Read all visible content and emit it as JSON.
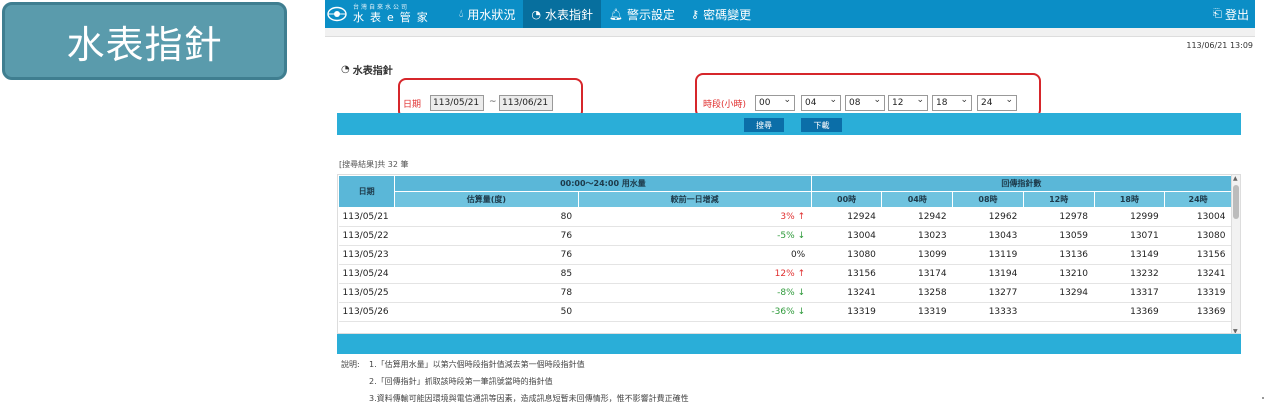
{
  "badge": {
    "label": "水表指針"
  },
  "header": {
    "logo_small": "台灣自來水公司",
    "logo_big": "水表e管家",
    "nav": [
      {
        "label": "用水狀況",
        "icon": "drop-icon"
      },
      {
        "label": "水表指針",
        "icon": "gauge-icon"
      },
      {
        "label": "警示設定",
        "icon": "bell-icon"
      },
      {
        "label": "密碼變更",
        "icon": "key-icon"
      }
    ],
    "logout_label": "登出",
    "colors": {
      "topbar": "#0b8ec6",
      "active": "#076f9e",
      "accent": "#2aaed8"
    }
  },
  "timestamp": "113/06/21 13:09",
  "page_title": "水表指針",
  "filter": {
    "date_label": "日期",
    "date_from": "113/05/21",
    "date_to": "113/06/21",
    "tilde": "~",
    "hour_label": "時段(小時)",
    "hours": [
      "00",
      "04",
      "08",
      "12",
      "18",
      "24"
    ]
  },
  "buttons": {
    "search": "搜尋",
    "download": "下載"
  },
  "result_count": "[搜尋結果]共 32 筆",
  "table": {
    "date_header": "日期",
    "usage_group": "00:00～24:00 用水量",
    "reading_group": "回傳指針數",
    "usage_cols": [
      "估算量(度)",
      "較前一日增減"
    ],
    "hour_cols": [
      "00時",
      "04時",
      "08時",
      "12時",
      "18時",
      "24時"
    ],
    "rows": [
      {
        "date": "113/05/21",
        "usage": "80",
        "change": "3%",
        "dir": "up",
        "readings": [
          "12924",
          "12942",
          "12962",
          "12978",
          "12999",
          "13004"
        ]
      },
      {
        "date": "113/05/22",
        "usage": "76",
        "change": "-5%",
        "dir": "down",
        "readings": [
          "13004",
          "13023",
          "13043",
          "13059",
          "13071",
          "13080"
        ]
      },
      {
        "date": "113/05/23",
        "usage": "76",
        "change": "0%",
        "dir": "none",
        "readings": [
          "13080",
          "13099",
          "13119",
          "13136",
          "13149",
          "13156"
        ]
      },
      {
        "date": "113/05/24",
        "usage": "85",
        "change": "12%",
        "dir": "up",
        "readings": [
          "13156",
          "13174",
          "13194",
          "13210",
          "13232",
          "13241"
        ]
      },
      {
        "date": "113/05/25",
        "usage": "78",
        "change": "-8%",
        "dir": "down",
        "readings": [
          "13241",
          "13258",
          "13277",
          "13294",
          "13317",
          "13319"
        ]
      },
      {
        "date": "113/05/26",
        "usage": "50",
        "change": "-36%",
        "dir": "down",
        "readings": [
          "13319",
          "13319",
          "13333",
          "",
          "13369",
          "13369"
        ]
      }
    ]
  },
  "notes": {
    "head": "說明:",
    "items": [
      "1.「估算用水量」以第六個時段指針值減去第一個時段指針值",
      "2.「回傳指針」抓取該時段第一筆訊號當時的指針值",
      "3.資料傳輸可能因環境與電信通訊等因素，造成訊息短暫未回傳情形，惟不影響計費正確性"
    ]
  }
}
